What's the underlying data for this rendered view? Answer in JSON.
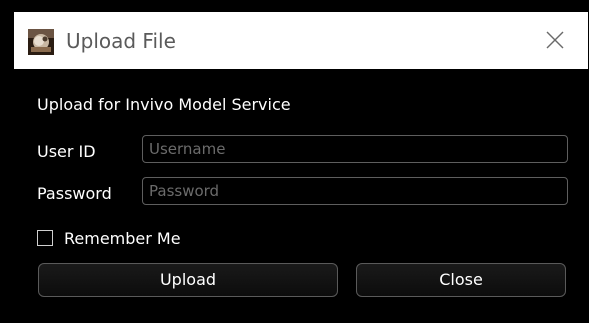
{
  "window": {
    "title": "Upload File",
    "app_icon": "app-logo-icon",
    "close_icon": "close-icon"
  },
  "form": {
    "heading": "Upload for Invivo Model Service",
    "user_id_label": "User ID",
    "user_id_value": "",
    "user_id_placeholder": "Username",
    "password_label": "Password",
    "password_value": "",
    "password_placeholder": "Password",
    "remember_label": "Remember Me",
    "remember_checked": false
  },
  "buttons": {
    "upload_label": "Upload",
    "close_label": "Close"
  },
  "colors": {
    "background": "#000000",
    "titlebar": "#ffffff",
    "title_text": "#5a5a5a",
    "border": "#5e5e5e"
  }
}
